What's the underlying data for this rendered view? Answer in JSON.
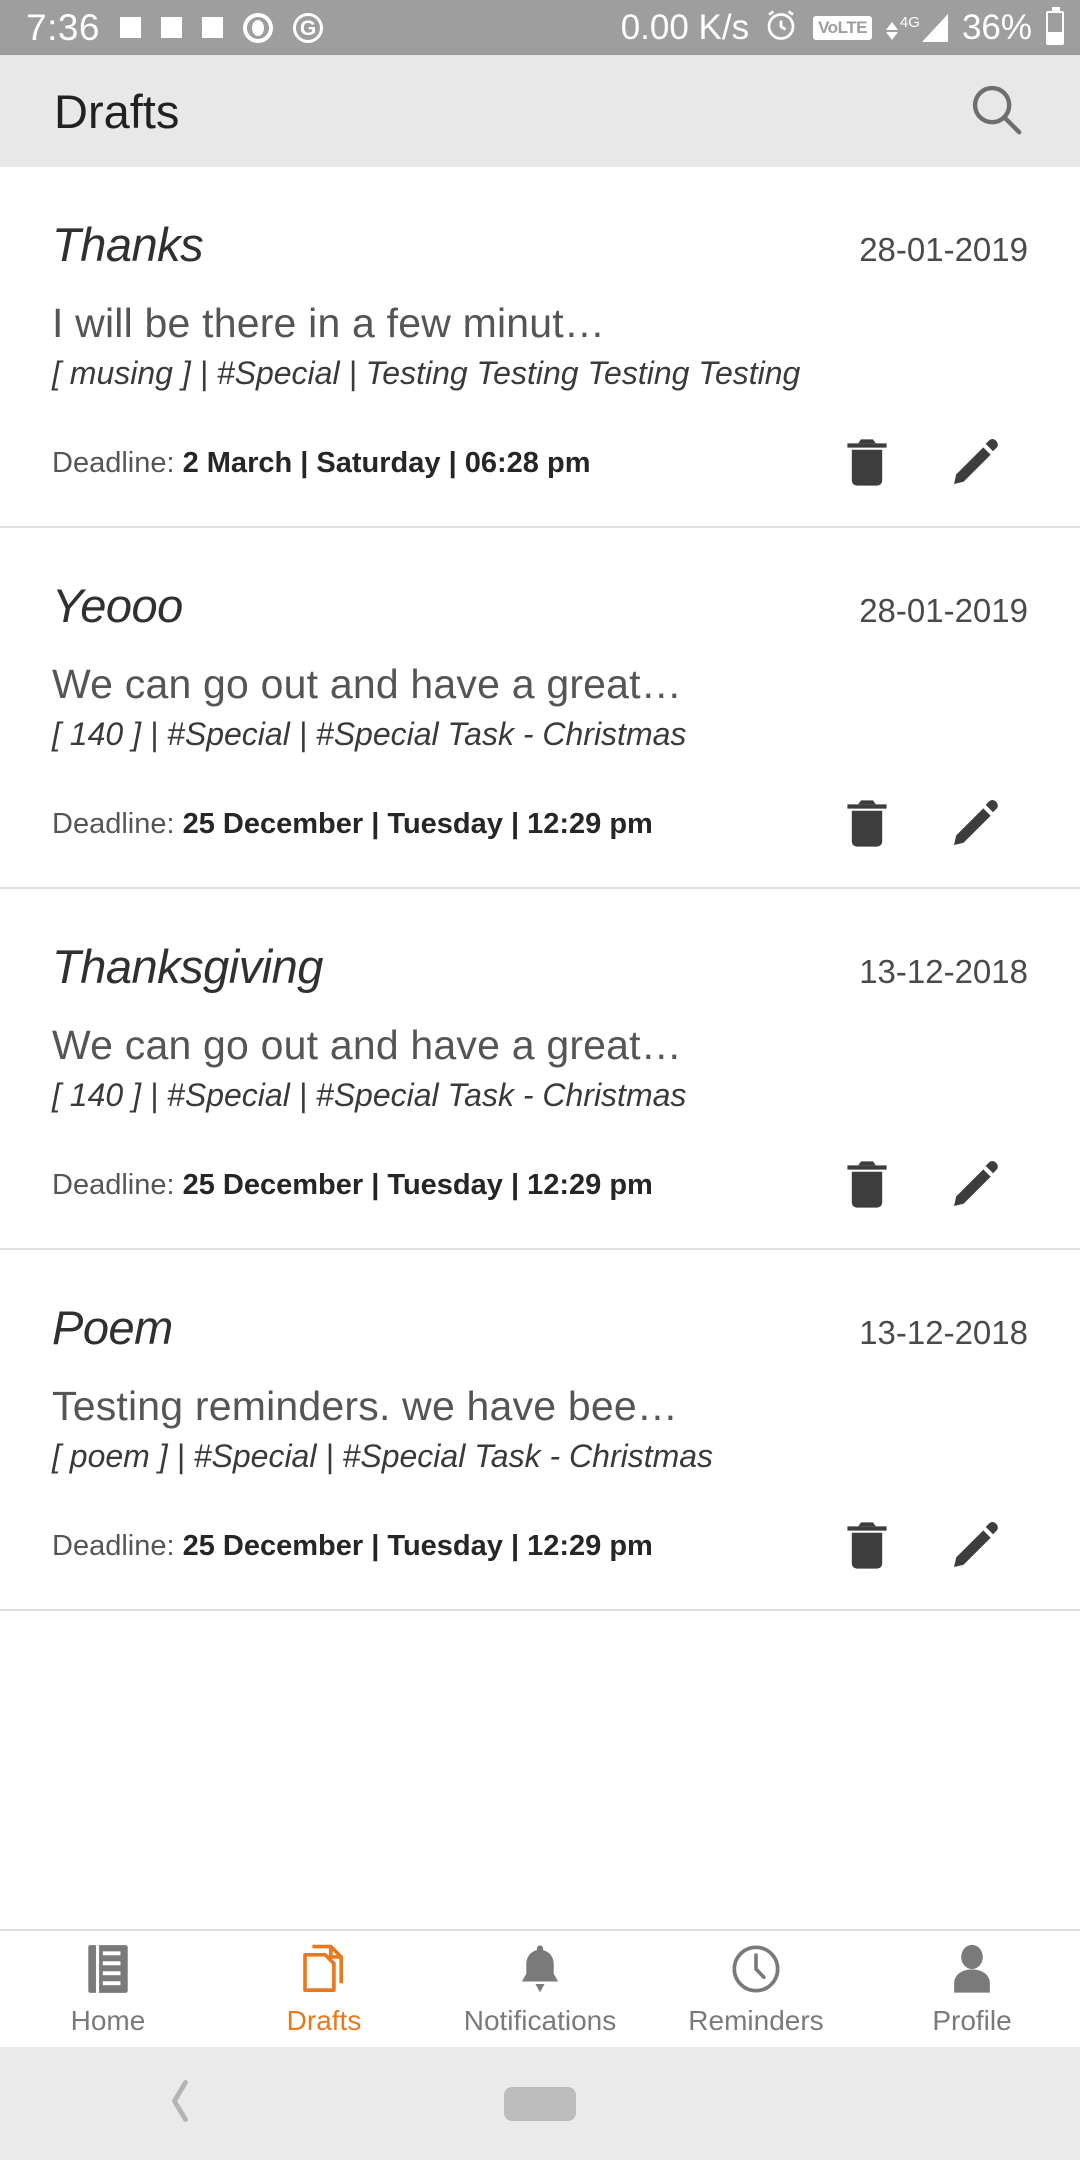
{
  "status_bar": {
    "time": "7:36",
    "net_speed": "0.00 K/s",
    "volte": "VoLTE",
    "network_type": "4G",
    "battery_percent": "36%",
    "icons": [
      "square-icon",
      "square-icon",
      "square-icon",
      "record-icon",
      "google-icon",
      "alarm-icon",
      "volte-icon",
      "signal-icon",
      "battery-icon"
    ],
    "background": "#9e9e9e"
  },
  "app_bar": {
    "title": "Drafts",
    "search_icon": "search-icon",
    "background": "#e8e8e8"
  },
  "list": {
    "deadline_label": "Deadline:",
    "delete_icon": "trash-icon",
    "edit_icon": "pencil-icon",
    "items": [
      {
        "title": "Thanks",
        "date": "28-01-2019",
        "preview": "I will be there in a few minut…",
        "tags": "[ musing ] | #Special | Testing Testing Testing Testing",
        "deadline_value": "2 March | Saturday | 06:28 pm"
      },
      {
        "title": "Yeooo",
        "date": "28-01-2019",
        "preview": "We can go out and have a great…",
        "tags": "[ 140 ] | #Special | #Special Task - Christmas",
        "deadline_value": "25 December | Tuesday | 12:29 pm"
      },
      {
        "title": "Thanksgiving",
        "date": "13-12-2018",
        "preview": "We can go out and have a great…",
        "tags": "[ 140 ] | #Special | #Special Task - Christmas",
        "deadline_value": "25 December | Tuesday | 12:29 pm"
      },
      {
        "title": "Poem",
        "date": "13-12-2018",
        "preview": "Testing reminders. we have bee…",
        "tags": "[ poem ] | #Special | #Special Task - Christmas",
        "deadline_value": "25 December | Tuesday | 12:29 pm"
      }
    ]
  },
  "bottom_nav": {
    "active_color": "#e8791e",
    "inactive_color": "#7a7a7a",
    "items": [
      {
        "label": "Home",
        "icon": "home-list-icon",
        "active": false
      },
      {
        "label": "Drafts",
        "icon": "documents-icon",
        "active": true
      },
      {
        "label": "Notifications",
        "icon": "bell-icon",
        "active": false
      },
      {
        "label": "Reminders",
        "icon": "clock-icon",
        "active": false
      },
      {
        "label": "Profile",
        "icon": "person-icon",
        "active": false
      }
    ]
  },
  "system_nav": {
    "back_icon": "back-chevron-icon",
    "home_icon": "home-pill-icon"
  }
}
